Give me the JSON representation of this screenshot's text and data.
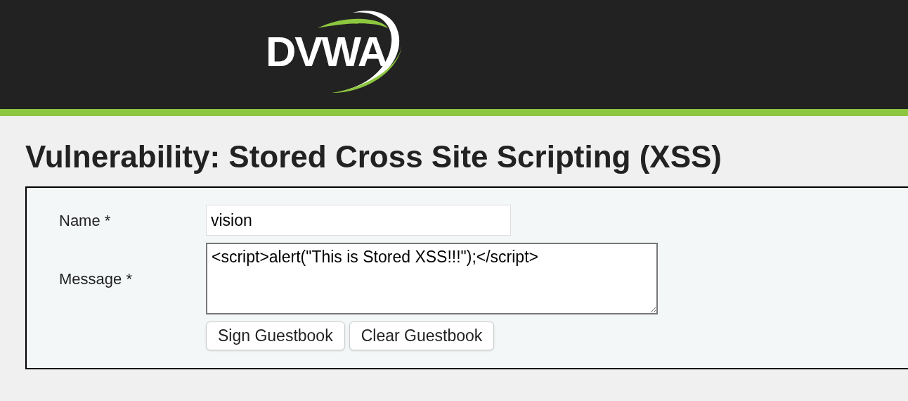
{
  "header": {
    "logo_text": "DVWA"
  },
  "title": "Vulnerability: Stored Cross Site Scripting (XSS)",
  "form": {
    "fields": [
      {
        "kind": "input",
        "label": "Name *",
        "value": "vision"
      },
      {
        "kind": "textarea",
        "label": "Message *",
        "value": "<script>alert(\"This is Stored XSS!!!\");</script>"
      }
    ],
    "buttons": [
      "Sign Guestbook",
      "Clear Guestbook"
    ]
  }
}
